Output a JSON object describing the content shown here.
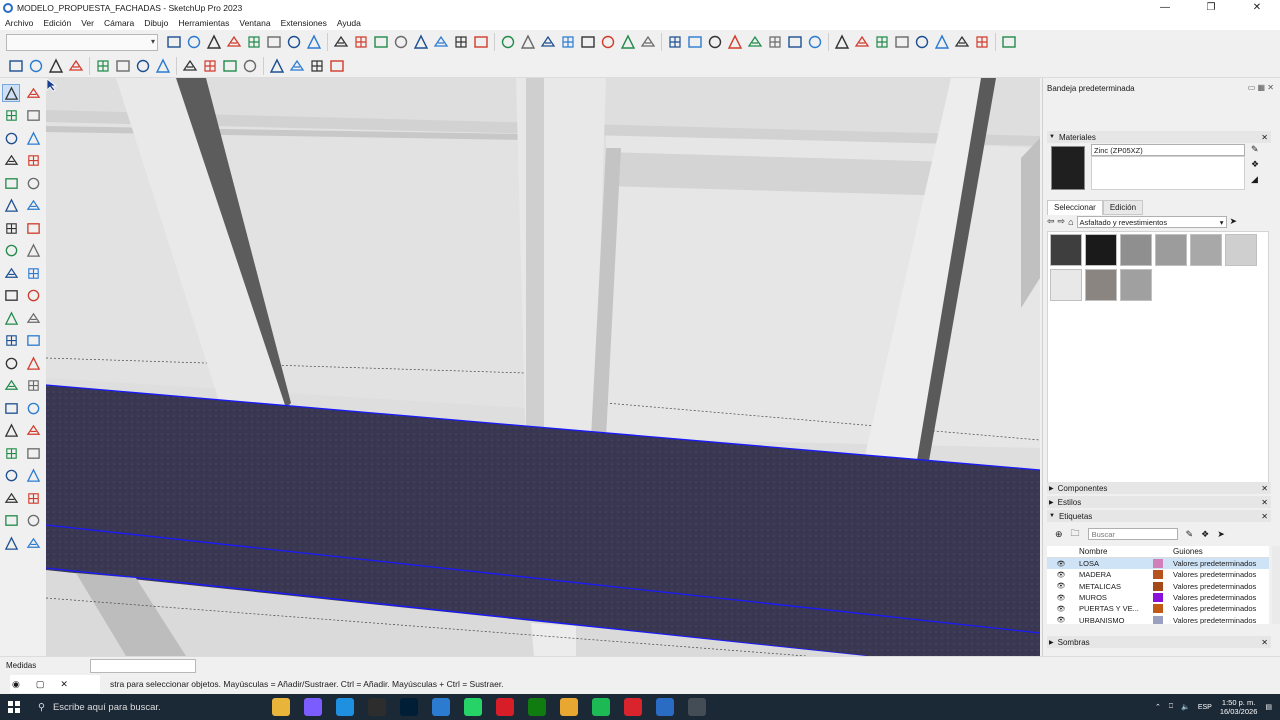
{
  "window": {
    "title": "MODELO_PROPUESTA_FACHADAS - SketchUp Pro 2023",
    "minimize": "—",
    "restore": "❐",
    "close": "✕"
  },
  "menu": [
    "Archivo",
    "Edición",
    "Ver",
    "Cámara",
    "Dibujo",
    "Herramientas",
    "Ventana",
    "Extensiones",
    "Ayuda"
  ],
  "toolbar": {
    "scene_select_value": "",
    "row1_icons": [
      "scene-settings-icon",
      "profile-icon",
      "record-icon",
      "camera-icon",
      "snapshot-icon",
      "look-around-icon",
      "settings-gear-icon",
      "box-icon",
      "iso-view-icon",
      "top-view-icon",
      "front-view-icon",
      "right-view-icon",
      "back-view-icon",
      "left-view-icon",
      "bottom-view-icon",
      "line-tool-icon",
      "freehand-icon",
      "arrows-icon",
      "outer-shell-icon",
      "intersect-icon",
      "union-icon",
      "subtract-icon",
      "trim-icon",
      "split-icon",
      "section-plane-icon",
      "section-fill-icon",
      "section-display-icon",
      "section-cut-icon",
      "position-camera-icon",
      "walk-icon",
      "look-icon",
      "text-icon",
      "3d-text-icon",
      "sandbox-icon",
      "smoove-icon",
      "stamp-icon",
      "drape-icon",
      "add-detail-icon",
      "flip-edge-icon",
      "xray-icon",
      "axes-icon"
    ],
    "row2_icons": [
      "orbit-icon",
      "pan-icon",
      "zoom-icon",
      "zoom-extents-icon",
      "warehouse-icon",
      "extension-warehouse-icon",
      "layout-icon",
      "style-builder-icon",
      "xray-toggle-icon",
      "back-edges-icon",
      "wireframe-icon",
      "hidden-line-icon",
      "shaded-icon",
      "shaded-textures-icon",
      "monochrome-icon",
      "checkmark-icon"
    ]
  },
  "tools": [
    "select-icon",
    "lasso-icon",
    "paint-icon",
    "eraser-icon",
    "tag-icon",
    "tape-icon",
    "pencil-icon",
    "arc-icon",
    "rectangle-icon",
    "rotated-rect-icon",
    "circle-icon",
    "polygon-icon",
    "line-icon",
    "freehand-line-icon",
    "pie-icon",
    "two-point-arc-icon",
    "move-icon",
    "push-pull-icon",
    "rotate-icon",
    "follow-me-icon",
    "scale-icon",
    "offset-icon",
    "tape-measure-icon",
    "protractor-icon",
    "dimension-icon",
    "text-tool-icon",
    "axes-tool-icon",
    "3d-text-tool-icon",
    "orbit-tool-icon",
    "pan-tool-icon",
    "zoom-tool-icon",
    "zoom-window-icon",
    "zoom-extents-tool-icon",
    "previous-icon",
    "position-camera-tool-icon",
    "walk-tool-icon",
    "look-around-tool-icon",
    "section-plane-tool-icon",
    "warehouse-tool-icon",
    "extension-tool-icon",
    "component-tool-icon",
    "sandbox-tool-icon"
  ],
  "tray": {
    "title": "Bandeja predeterminada",
    "materials": {
      "header": "Materiales",
      "current_name": "Zinc (ZP05XZ)",
      "current_color": "#1f1f1f",
      "tab_select": "Seleccionar",
      "tab_edit": "Edición",
      "library": "Asfaltado y revestimientos",
      "swatches": [
        "#3e3e3e",
        "#1a1a1a",
        "#8f8f8f",
        "#9c9c9c",
        "#a8a8a8",
        "#cfcfcf",
        "#e8e8e8",
        "#8a8580",
        "#a0a0a0"
      ]
    },
    "components_header": "Componentes",
    "styles_header": "Estilos",
    "tags": {
      "header": "Etiquetas",
      "search_placeholder": "Buscar",
      "col_name": "Nombre",
      "col_dashes": "Guiones",
      "rows": [
        {
          "name": "LOSA",
          "color": "#d07fb8",
          "dashes": "Valores predeterminados"
        },
        {
          "name": "MADERA",
          "color": "#b5521e",
          "dashes": "Valores predeterminados"
        },
        {
          "name": "METALICAS",
          "color": "#a34a18",
          "dashes": "Valores predeterminados"
        },
        {
          "name": "MUROS",
          "color": "#8a11d9",
          "dashes": "Valores predeterminados"
        },
        {
          "name": "PUERTAS Y VE...",
          "color": "#c05a14",
          "dashes": "Valores predeterminados"
        },
        {
          "name": "URBANISMO",
          "color": "#9aa0c0",
          "dashes": "Valores predeterminados"
        }
      ]
    },
    "shadows_header": "Sombras"
  },
  "status": {
    "measure_label": "Medidas",
    "measure_value": "",
    "hint": "stra para seleccionar objetos. Mayúsculas = Añadir/Sustraer. Ctrl = Añadir. Mayúsculas + Ctrl = Sustraer."
  },
  "taskbar": {
    "search_placeholder": "Escribe aquí para buscar.",
    "apps": [
      "file-explorer-icon",
      "copilot-icon",
      "edge-icon",
      "epic-icon",
      "photoshop-icon",
      "store-icon",
      "whatsapp-icon",
      "acrobat-icon",
      "xbox-icon",
      "folder-icon",
      "spotify-icon",
      "opera-icon",
      "sketchup-icon",
      "calculator-icon"
    ],
    "lang": "ESP",
    "time": "1:50 p. m.",
    "date": "16/03/2026"
  },
  "colors": {
    "floor": "#3a3752",
    "edge_selected": "#1a1aff",
    "wall": "#e4e4e4",
    "column_dark": "#555555"
  }
}
